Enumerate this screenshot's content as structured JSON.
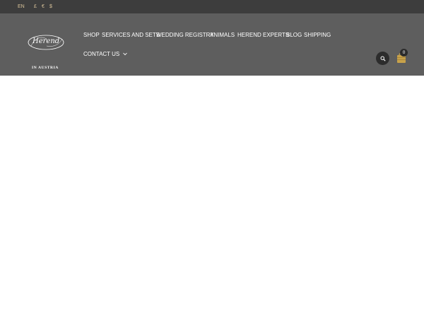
{
  "topbar": {
    "language": "EN",
    "currencies": [
      "£",
      "€",
      "$"
    ]
  },
  "logo": {
    "script_text": "Herend",
    "tagline": "IN AUSTRIA"
  },
  "nav": {
    "items": [
      {
        "label": "SHOP"
      },
      {
        "label": "SERVICES AND SETS"
      },
      {
        "label": "WEDDING REGISTRY"
      },
      {
        "label": "ANIMALS"
      },
      {
        "label": "HEREND EXPERTS"
      },
      {
        "label": "BLOG"
      },
      {
        "label": "SHIPPING"
      },
      {
        "label": "CONTACT US"
      }
    ],
    "dropdown_icon": "chevron-down-icon"
  },
  "header_actions": {
    "search_icon": "search-icon",
    "cart_icon": "shopping-bag-icon",
    "cart_count": "0"
  },
  "colors": {
    "topbar_bg": "#3d3d3d",
    "header_bg": "#5e5e5e",
    "accent_gold": "#d9c39a",
    "cart_gold": "#c8a24a"
  }
}
